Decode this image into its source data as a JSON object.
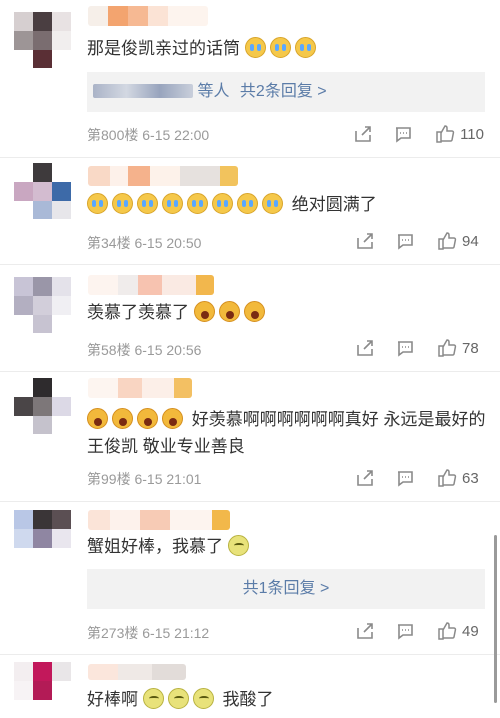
{
  "comments": [
    {
      "text": "那是俊凯亲过的话筒",
      "emoji_after": [
        "cry",
        "cry",
        "cry"
      ],
      "replies_label": "共2条回复 >",
      "replies_prefix": "等人",
      "floor": "第800楼",
      "time": "6-15 22:00",
      "likes": "110"
    },
    {
      "emoji_before": [
        "cry",
        "cry",
        "cry",
        "cry",
        "cry",
        "cry",
        "cry",
        "cry"
      ],
      "text": "绝对圆满了",
      "floor": "第34楼",
      "time": "6-15 20:50",
      "likes": "94"
    },
    {
      "text": "羡慕了羡慕了",
      "emoji_after": [
        "shout",
        "shout",
        "shout"
      ],
      "floor": "第58楼",
      "time": "6-15 20:56",
      "likes": "78"
    },
    {
      "emoji_before": [
        "shout",
        "shout",
        "shout",
        "shout"
      ],
      "text": "好羡慕啊啊啊啊啊啊真好 永远是最好的王俊凯 敬业专业善良",
      "floor": "第99楼",
      "time": "6-15 21:01",
      "likes": "63"
    },
    {
      "text": "蟹姐好棒，我慕了",
      "emoji_after": [
        "sour"
      ],
      "replies_label": "共1条回复 >",
      "floor": "第273楼",
      "time": "6-15 21:12",
      "likes": "49"
    },
    {
      "text": "好棒啊",
      "emoji_after": [
        "sour",
        "sour",
        "sour"
      ],
      "text_after": "我酸了"
    }
  ],
  "icons": {
    "share": "share-icon",
    "comment": "comment-icon",
    "like": "thumbs-up-icon"
  },
  "colors": {
    "link": "#5b7ca8",
    "meta": "#9a9a9a",
    "reply_bg": "#f2f2f2"
  }
}
